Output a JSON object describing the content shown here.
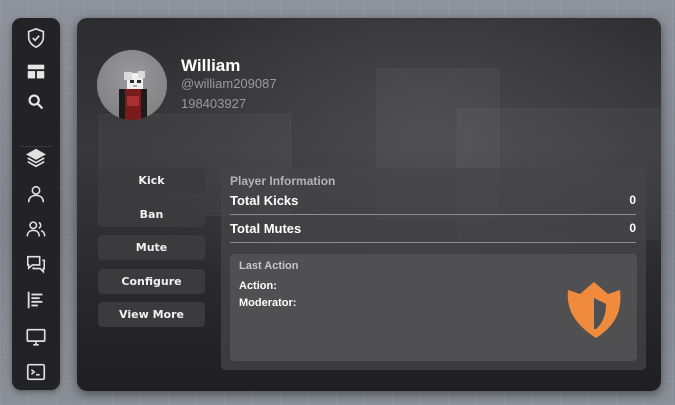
{
  "sidebar": {
    "icons": [
      "shield-icon",
      "layout-icon",
      "search-icon",
      "layers-icon",
      "user-icon",
      "users-icon",
      "chat-icon",
      "list-icon",
      "monitor-icon",
      "terminal-icon"
    ]
  },
  "profile": {
    "display_name": "William",
    "username": "@william209087",
    "user_id": "198403927"
  },
  "actions": {
    "kick": "Kick",
    "ban": "Ban",
    "mute": "Mute",
    "configure": "Configure",
    "view_more": "View More"
  },
  "player_info": {
    "title": "Player Information",
    "stats": [
      {
        "label": "Total Kicks",
        "value": "0"
      },
      {
        "label": "Total Mutes",
        "value": "0"
      }
    ],
    "last_action": {
      "title": "Last Action",
      "action_label": "Action:",
      "moderator_label": "Moderator:"
    }
  },
  "colors": {
    "accent_orange": "#f08a3c",
    "panel_dark": "#2d2d2f",
    "sidebar_bg": "#232325"
  }
}
